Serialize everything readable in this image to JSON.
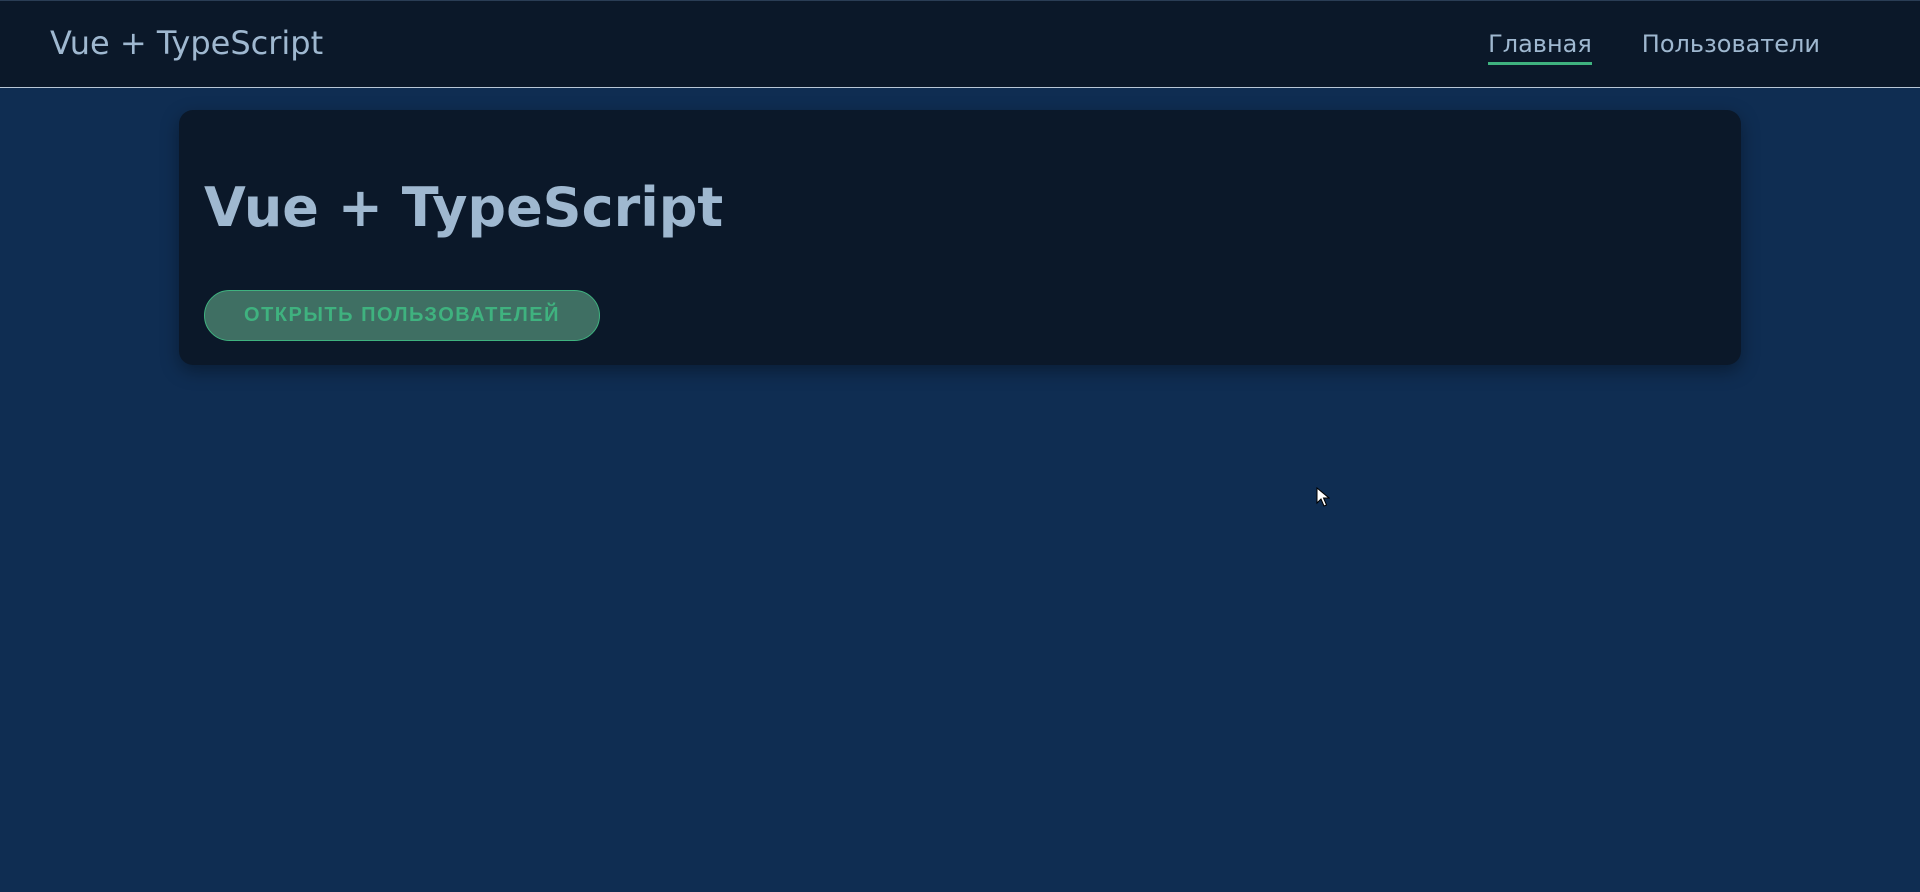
{
  "header": {
    "brand": "Vue + TypeScript",
    "nav": [
      {
        "label": "Главная",
        "active": true
      },
      {
        "label": "Пользователи",
        "active": false
      }
    ]
  },
  "main": {
    "title": "Vue + TypeScript",
    "open_users_label": "ОТКРЫТЬ ПОЛЬЗОВАТЕЛЕЙ"
  },
  "colors": {
    "page_background": "#0f2d52",
    "header_background": "#0b1829",
    "card_background": "#0b1829",
    "text": "#9fb8d0",
    "accent": "#3fb27f",
    "button_background": "#3f6f63"
  },
  "icons": {
    "pointer": "mouse-pointer-icon"
  }
}
